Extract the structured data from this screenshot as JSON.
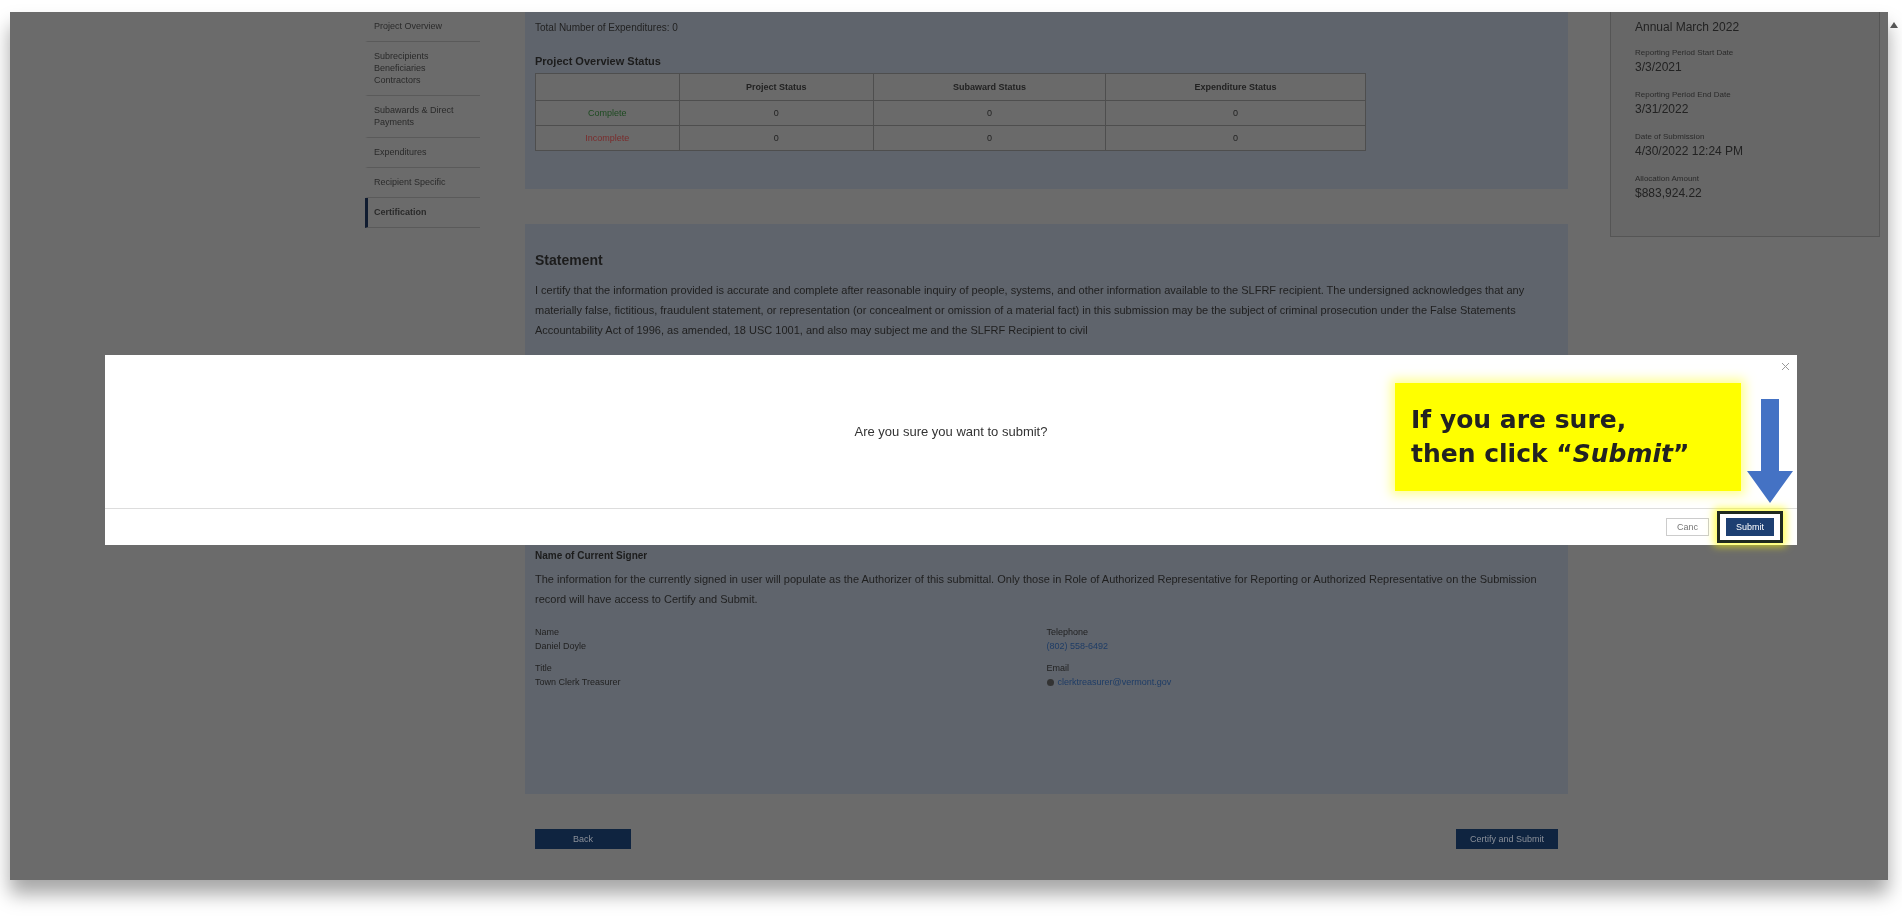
{
  "sidebar": {
    "items": [
      {
        "label": "Project Overview",
        "selected": false
      },
      {
        "label": "Subrecipients Beneficiaries Contractors",
        "selected": false
      },
      {
        "label": "Subawards & Direct Payments",
        "selected": false
      },
      {
        "label": "Expenditures",
        "selected": false
      },
      {
        "label": "Recipient Specific",
        "selected": false
      },
      {
        "label": "Certification",
        "selected": true
      }
    ]
  },
  "overview": {
    "expenditure_total": "Total Number of Expenditures: 0",
    "status_title": "Project Overview Status",
    "table": {
      "columns": [
        "Project Status",
        "Subaward Status",
        "Expenditure Status"
      ],
      "rows": [
        {
          "label": "Complete",
          "color": "#1d4a20",
          "cells": [
            "0",
            "0",
            "0"
          ]
        },
        {
          "label": "Incomplete",
          "color": "#7a2c2c",
          "cells": [
            "0",
            "0",
            "0"
          ]
        }
      ]
    }
  },
  "summary": {
    "title": "Annual March 2022",
    "fields": [
      {
        "label": "Reporting Period Start Date",
        "value": "3/3/2021"
      },
      {
        "label": "Reporting Period End Date",
        "value": "3/31/2022"
      },
      {
        "label": "Date of Submission",
        "value": "4/30/2022 12:24 PM"
      },
      {
        "label": "Allocation Amount",
        "value": "$883,924.22"
      }
    ]
  },
  "statement": {
    "title": "Statement",
    "text": "I certify that the information provided is accurate and complete after reasonable inquiry of people, systems, and other information available to the SLFRF recipient. The undersigned acknowledges that any materially false, fictitious, fraudulent statement, or representation (or concealment or omission of a material fact) in this submission may be the subject of criminal prosecution under the False Statements Accountability Act of 1996, as amended, 18 USC 1001, and also may subject me and the SLFRF Recipient to civil"
  },
  "signer": {
    "title": "Name of Current Signer",
    "note": "The information for the currently signed in user will populate as the Authorizer of this submittal. Only those in Role of Authorized Representative for Reporting or Authorized Representative on the Submission record will have access to Certify and Submit.",
    "fields": [
      {
        "label": "Name",
        "value": "Daniel Doyle",
        "kind": "plain"
      },
      {
        "label": "Telephone",
        "value": "(802) 558-6492",
        "kind": "link"
      },
      {
        "label": "Title",
        "value": "Town Clerk Treasurer",
        "kind": "plain"
      },
      {
        "label": "Email",
        "value": "clerktreasurer@vermont.gov",
        "kind": "email"
      }
    ]
  },
  "actions": {
    "back": "Back",
    "submit": "Certify and Submit"
  },
  "modal": {
    "message": "Are you sure you want to submit?",
    "buttons": [
      {
        "label": "Canc",
        "kind": "secondary",
        "highlighted": false
      },
      {
        "label": "Submit",
        "kind": "primary",
        "highlighted": true
      }
    ]
  },
  "callout": {
    "lines": [
      "If you are sure,",
      "then click “*Submit*”"
    ]
  }
}
